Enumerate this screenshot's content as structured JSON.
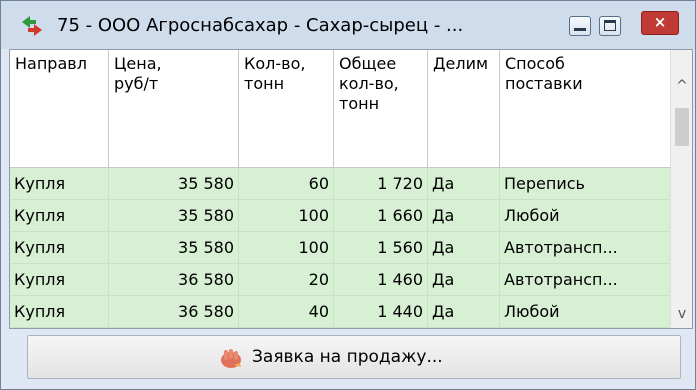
{
  "window": {
    "title": "75 - ООО Агроснабсахар - Сахар-сырец - ...",
    "close_label": "×"
  },
  "grid": {
    "columns": [
      "Направл",
      "Цена,\nруб/т",
      "Кол-во,\nтонн",
      "Общее\nкол-во,\nтонн",
      "Делим",
      "Способ\nпоставки"
    ],
    "rows": [
      [
        "Купля",
        "35 580",
        "60",
        "1 720",
        "Да",
        "Перепись"
      ],
      [
        "Купля",
        "35 580",
        "100",
        "1 660",
        "Да",
        "Любой"
      ],
      [
        "Купля",
        "35 580",
        "100",
        "1 560",
        "Да",
        "Автотрансп..."
      ],
      [
        "Купля",
        "36 580",
        "20",
        "1 460",
        "Да",
        "Автотрансп..."
      ],
      [
        "Купля",
        "36 580",
        "40",
        "1 440",
        "Да",
        "Любой"
      ]
    ],
    "row_color": "#d7f0d4"
  },
  "scrollbar": {
    "up_glyph": "^",
    "down_glyph": "v"
  },
  "action": {
    "label": "Заявка на продажу..."
  }
}
